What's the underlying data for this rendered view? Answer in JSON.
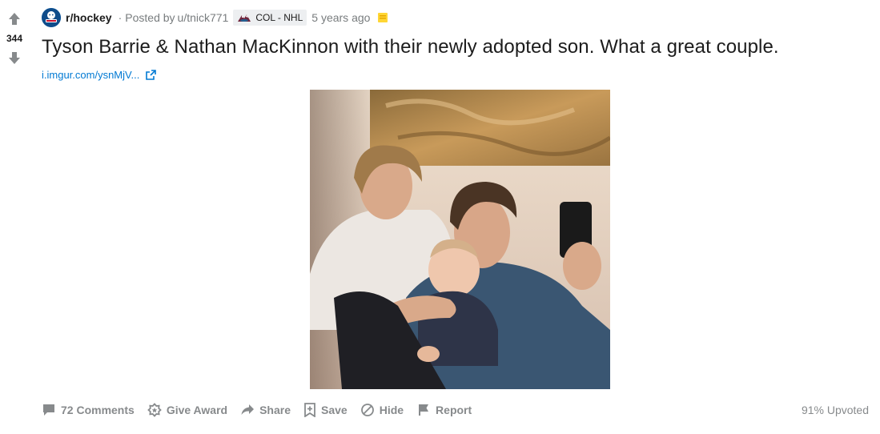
{
  "post": {
    "score": "344",
    "subreddit": "r/hockey",
    "posted_by_prefix": "Posted by",
    "username": "u/tnick771",
    "flair": "COL - NHL",
    "time_ago": "5 years ago",
    "title": "Tyson Barrie & Nathan MacKinnon with their newly adopted son. What a great couple.",
    "link_text": "i.imgur.com/ysnMjV...",
    "image_alt": "Photo of two men with a baby taking a selfie"
  },
  "actions": {
    "comments": "72 Comments",
    "give_award": "Give Award",
    "share": "Share",
    "save": "Save",
    "hide": "Hide",
    "report": "Report",
    "upvoted": "91% Upvoted"
  },
  "icons": {
    "upvote": "upvote-arrow-icon",
    "downvote": "downvote-arrow-icon",
    "subreddit": "hockey-subreddit-icon",
    "flair": "avalanche-logo-icon",
    "award": "gold-award-icon",
    "external": "external-link-icon",
    "comments": "comment-icon",
    "give_award": "award-icon",
    "share": "share-icon",
    "save": "save-icon",
    "hide": "hide-icon",
    "report": "report-flag-icon"
  },
  "colors": {
    "link": "#0079d3",
    "meta": "#787c7e",
    "action": "#878a8c",
    "vote_arrow": "#878a8c",
    "award": "#ffd635"
  }
}
